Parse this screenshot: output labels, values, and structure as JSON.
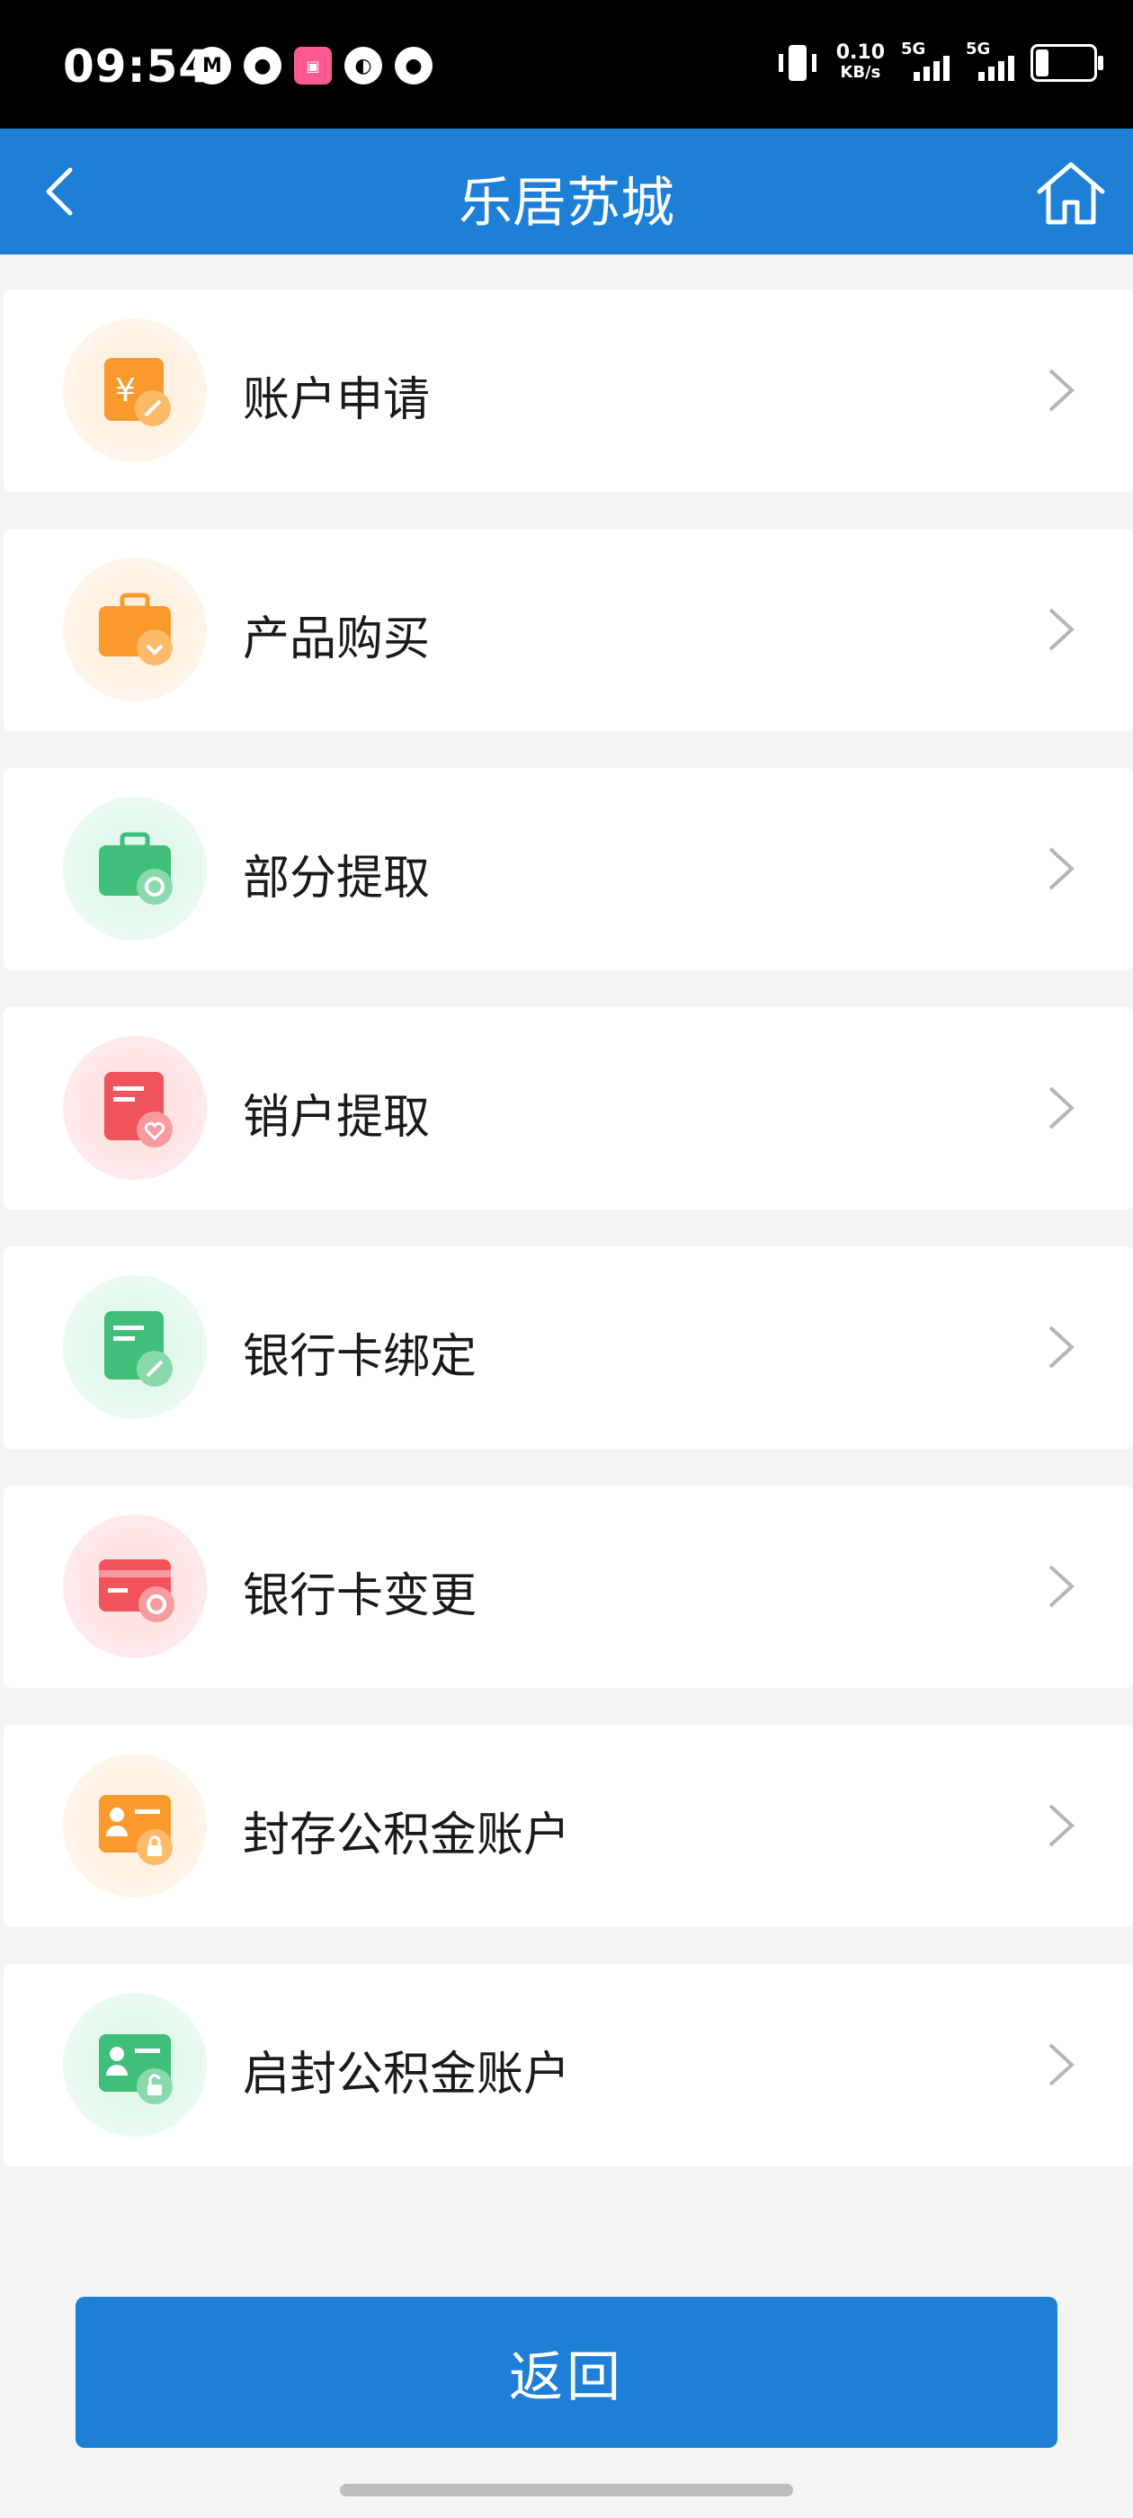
{
  "status_bar": {
    "time": "09:54",
    "net_speed_value": "0.10",
    "net_speed_unit": "KB/s",
    "signal1_label": "5G",
    "signal2_label": "5G"
  },
  "header": {
    "title": "乐居苏城"
  },
  "menu": {
    "items": [
      {
        "label": "账户申请",
        "icon": "account-apply-icon",
        "color": "#fb9a2c"
      },
      {
        "label": "产品购买",
        "icon": "product-buy-icon",
        "color": "#fb9a2c"
      },
      {
        "label": "部分提取",
        "icon": "partial-withdraw-icon",
        "color": "#3fbf7a"
      },
      {
        "label": "销户提取",
        "icon": "close-account-withdraw-icon",
        "color": "#f2545b"
      },
      {
        "label": "银行卡绑定",
        "icon": "bank-card-bind-icon",
        "color": "#3fbf7a"
      },
      {
        "label": "银行卡变更",
        "icon": "bank-card-change-icon",
        "color": "#f2545b"
      },
      {
        "label": "封存公积金账户",
        "icon": "seal-fund-account-icon",
        "color": "#fb9a2c"
      },
      {
        "label": "启封公积金账户",
        "icon": "unseal-fund-account-icon",
        "color": "#3fbf7a"
      }
    ]
  },
  "footer": {
    "return_label": "返回"
  },
  "colors": {
    "primary": "#1d7fd6",
    "background": "#f4f4f4",
    "orange": "#fb9a2c",
    "green": "#3fbf7a",
    "red": "#f2545b"
  }
}
